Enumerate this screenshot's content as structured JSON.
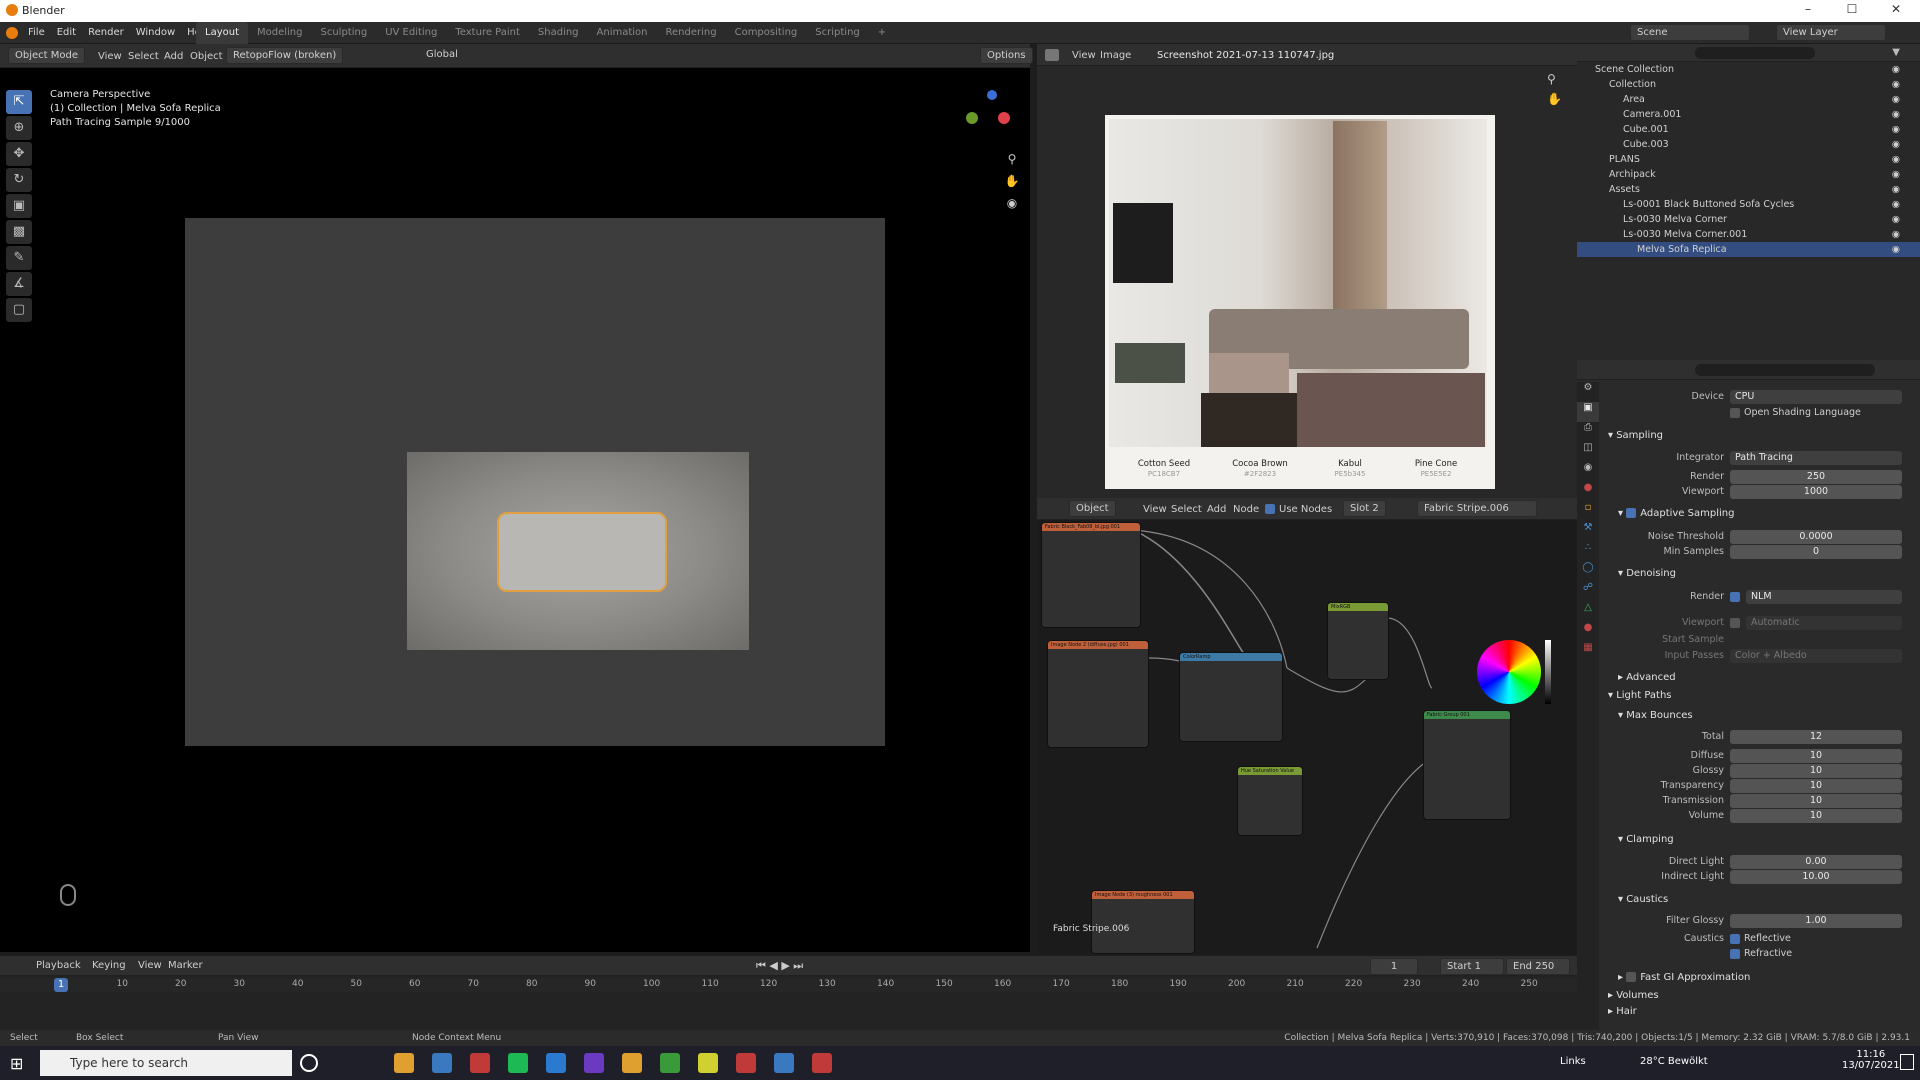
{
  "window": {
    "title": "Blender"
  },
  "menu": [
    "File",
    "Edit",
    "Render",
    "Window",
    "Help"
  ],
  "workspaces": [
    "Layout",
    "Modeling",
    "Sculpting",
    "UV Editing",
    "Texture Paint",
    "Shading",
    "Animation",
    "Rendering",
    "Compositing",
    "Scripting",
    "+"
  ],
  "scene": {
    "label": "Scene",
    "view_layer": "View Layer"
  },
  "viewport_header": {
    "mode": "Object Mode",
    "menus": [
      "View",
      "Select",
      "Add",
      "Object"
    ],
    "addon": "RetopoFlow (broken)",
    "transform": "Global",
    "options": "Options"
  },
  "viewport_overlay": {
    "line1": "Camera Perspective",
    "line2": "(1) Collection | Melva Sofa Replica",
    "line3": "Path Tracing Sample 9/1000"
  },
  "image_editor": {
    "menus": [
      "View",
      "Image"
    ],
    "filename": "Screenshot 2021-07-13 110747.jpg",
    "swatches": [
      {
        "name": "Cotton Seed",
        "code": "PC18CB7",
        "color": "#4b5146"
      },
      {
        "name": "Cocoa Brown",
        "code": "#2F2823",
        "color": "#a9958a"
      },
      {
        "name": "Kabul",
        "code": "PE5b345",
        "color": "#2f2823"
      },
      {
        "name": "Pine Cone",
        "code": "PE5E5E2",
        "color": "#6a5550"
      }
    ]
  },
  "node_editor": {
    "type": "Object",
    "menus": [
      "View",
      "Select",
      "Add",
      "Node"
    ],
    "use_nodes": "Use Nodes",
    "slot": "Slot 2",
    "material": "Fabric Stripe.006",
    "footer_label": "Fabric Stripe.006",
    "nodes": [
      {
        "title": "Fabric Black_Fab08_bl.jpg 001",
        "color": "#c0603a"
      },
      {
        "title": "Image Node 2 (diffuse.jpg) 001",
        "color": "#c0603a"
      },
      {
        "title": "ColorRamp",
        "color": "#3e7aa6"
      },
      {
        "title": "MixRGB",
        "color": "#7a9a36"
      },
      {
        "title": "Hue Saturation Value",
        "color": "#7a9a36"
      },
      {
        "title": "Fabric Group 001",
        "color": "#3e8a4a"
      },
      {
        "title": "Image Node (3) roughness 001",
        "color": "#c0603a"
      }
    ]
  },
  "outliner": {
    "rows": [
      {
        "label": "Scene Collection",
        "indent": 0,
        "selected": false
      },
      {
        "label": "Collection",
        "indent": 1,
        "selected": false
      },
      {
        "label": "Area",
        "indent": 2,
        "selected": false
      },
      {
        "label": "Camera.001",
        "indent": 2,
        "selected": false
      },
      {
        "label": "Cube.001",
        "indent": 2,
        "selected": false
      },
      {
        "label": "Cube.003",
        "indent": 2,
        "selected": false
      },
      {
        "label": "PLANS",
        "indent": 1,
        "selected": false
      },
      {
        "label": "Archipack",
        "indent": 1,
        "selected": false
      },
      {
        "label": "Assets",
        "indent": 1,
        "selected": false
      },
      {
        "label": "Ls-0001 Black Buttoned Sofa Cycles",
        "indent": 2,
        "selected": false
      },
      {
        "label": "Ls-0030 Melva Corner",
        "indent": 2,
        "selected": false
      },
      {
        "label": "Ls-0030 Melva Corner.001",
        "indent": 2,
        "selected": false
      },
      {
        "label": "Melva Sofa Replica",
        "indent": 3,
        "selected": true
      }
    ]
  },
  "properties": {
    "device_label": "Device",
    "device": "CPU",
    "osl": "Open Shading Language",
    "sampling": "Sampling",
    "integrator_label": "Integrator",
    "integrator": "Path Tracing",
    "render_label": "Render",
    "render_samples": "250",
    "viewport_label": "Viewport",
    "viewport_samples": "1000",
    "adaptive": "Adaptive Sampling",
    "noise_label": "Noise Threshold",
    "noise": "0.0000",
    "min_label": "Min Samples",
    "min_samples": "0",
    "denoising": "Denoising",
    "denoise_render": "NLM",
    "denoise_viewport": "Automatic",
    "start_sample_label": "Start Sample",
    "input_passes_label": "Input Passes",
    "input_passes": "Color + Albedo",
    "advanced": "Advanced",
    "light_paths": "Light Paths",
    "max_bounces": "Max Bounces",
    "bounces": [
      {
        "label": "Total",
        "value": "12"
      },
      {
        "label": "Diffuse",
        "value": "10"
      },
      {
        "label": "Glossy",
        "value": "10"
      },
      {
        "label": "Transparency",
        "value": "10"
      },
      {
        "label": "Transmission",
        "value": "10"
      },
      {
        "label": "Volume",
        "value": "10"
      }
    ],
    "clamping": "Clamping",
    "direct_label": "Direct Light",
    "direct": "0.00",
    "indirect_label": "Indirect Light",
    "indirect": "10.00",
    "caustics": "Caustics",
    "filter_glossy_label": "Filter Glossy",
    "filter_glossy": "1.00",
    "caustics_label": "Caustics",
    "reflective": "Reflective",
    "refractive": "Refractive",
    "fast_gi": "Fast GI Approximation",
    "volumes": "Volumes",
    "hair": "Hair"
  },
  "timeline": {
    "menus": [
      "Playback",
      "Keying",
      "View",
      "Marker"
    ],
    "current": "1",
    "start_label": "Start",
    "start": "1",
    "end_label": "End",
    "end": "250",
    "ticks": [
      "1",
      "10",
      "20",
      "30",
      "40",
      "50",
      "60",
      "70",
      "80",
      "90",
      "100",
      "110",
      "120",
      "130",
      "140",
      "150",
      "160",
      "170",
      "180",
      "190",
      "200",
      "210",
      "220",
      "230",
      "240",
      "250"
    ]
  },
  "statusbar": {
    "select": "Select",
    "box_select": "Box Select",
    "pan_view": "Pan View",
    "node_menu": "Node Context Menu",
    "stats": "Collection | Melva Sofa Replica | Verts:370,910 | Faces:370,098 | Tris:740,200 | Objects:1/5 | Memory: 2.32 GiB | VRAM: 5.7/8.0 GiB | 2.93.1"
  },
  "taskbar": {
    "search_placeholder": "Type here to search",
    "links": "Links",
    "weather": "28°C  Bewölkt",
    "time": "11:16",
    "date": "13/07/2021",
    "app_colors": [
      "#e0a030",
      "#3a78c0",
      "#c03a3a",
      "#1db954",
      "#2a7ad0",
      "#6a3ac0",
      "#e0a030",
      "#3a9a3a",
      "#d0d030",
      "#c03a3a",
      "#3a78c0",
      "#c03a3a"
    ]
  }
}
